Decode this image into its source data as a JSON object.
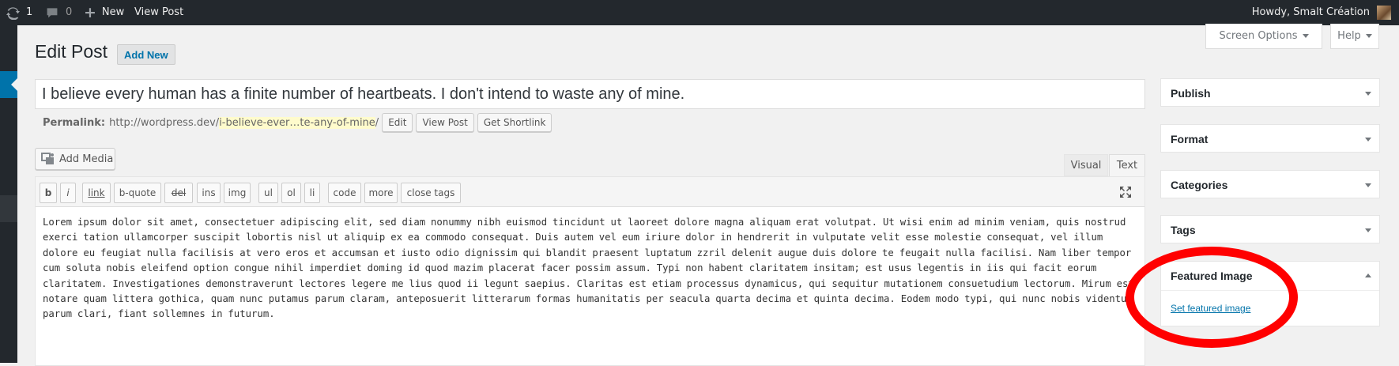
{
  "adminbar": {
    "updates_count": "1",
    "comments_count": "0",
    "new_label": "New",
    "view_post_label": "View Post",
    "greeting": "Howdy, Smalt Création"
  },
  "screen_options": {
    "label": "Screen Options"
  },
  "help": {
    "label": "Help"
  },
  "page": {
    "title": "Edit Post",
    "add_new": "Add New"
  },
  "post": {
    "title": "I believe every human has a finite number of heartbeats. I don't intend to waste any of mine.",
    "permalink_label": "Permalink:",
    "permalink_base": "http://wordpress.dev/",
    "permalink_slug": "i-believe-ever…te-any-of-mine",
    "permalink_trail": "/",
    "edit_label": "Edit",
    "view_post_label": "View Post",
    "shortlink_label": "Get Shortlink"
  },
  "editor": {
    "add_media": "Add Media",
    "tab_visual": "Visual",
    "tab_text": "Text",
    "quicktags": [
      "b",
      "i",
      "link",
      "b-quote",
      "del",
      "ins",
      "img",
      "ul",
      "ol",
      "li",
      "code",
      "more",
      "close tags"
    ],
    "content": "Lorem ipsum dolor sit amet, consectetuer adipiscing elit, sed diam nonummy nibh euismod tincidunt ut laoreet dolore magna aliquam erat volutpat. Ut wisi enim ad minim veniam, quis nostrud exerci tation ullamcorper suscipit lobortis nisl ut aliquip ex ea commodo consequat. Duis autem vel eum iriure dolor in hendrerit in vulputate velit esse molestie consequat, vel illum dolore eu feugiat nulla facilisis at vero eros et accumsan et iusto odio dignissim qui blandit praesent luptatum zzril delenit augue duis dolore te feugait nulla facilisi. Nam liber tempor cum soluta nobis eleifend option congue nihil imperdiet doming id quod mazim placerat facer possim assum. Typi non habent claritatem insitam; est usus legentis in iis qui facit eorum claritatem. Investigationes demonstraverunt lectores legere me lius quod ii legunt saepius. Claritas est etiam processus dynamicus, qui sequitur mutationem consuetudium lectorum. Mirum est notare quam littera gothica, quam nunc putamus parum claram, anteposuerit litterarum formas humanitatis per seacula quarta decima et quinta decima. Eodem modo typi, qui nunc nobis videntur parum clari, fiant sollemnes in futurum."
  },
  "sidebar": {
    "publish": "Publish",
    "format": "Format",
    "categories": "Categories",
    "tags": "Tags",
    "featured_image": "Featured Image",
    "set_featured_image": "Set featured image"
  },
  "colors": {
    "link": "#0073aa",
    "adminbar": "#23282d",
    "highlight": "#ff0000"
  }
}
